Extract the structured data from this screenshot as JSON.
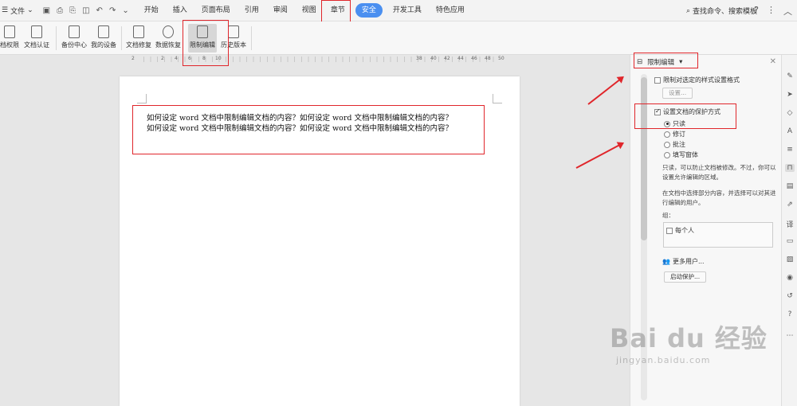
{
  "menubar": {
    "file_label": "文件",
    "tabs": [
      "开始",
      "插入",
      "页面布局",
      "引用",
      "审阅",
      "视图",
      "章节",
      "安全",
      "开发工具",
      "特色应用"
    ],
    "search_label": "查找命令、搜索模板"
  },
  "ribbon": {
    "buttons": [
      "档权限",
      "文档认证",
      "备份中心",
      "我的设备",
      "文档修复",
      "数据恢复",
      "限制编辑",
      "历史版本"
    ]
  },
  "ruler": {
    "ticks": [
      "2",
      "2",
      "4",
      "6",
      "8",
      "10",
      "38",
      "40",
      "42",
      "44",
      "46",
      "48",
      "50"
    ]
  },
  "document": {
    "lines": [
      "如何设定 word 文档中限制编辑文档的内容？如何设定 word 文档中限制编辑文档的内容？",
      "如何设定 word 文档中限制编辑文档的内容？如何设定 word 文档中限制编辑文档的内容？"
    ]
  },
  "panel": {
    "title": "限制编辑",
    "format_restrict_label": "限制对选定的样式设置格式",
    "settings_button": "设置...",
    "protect_label": "设置文档的保护方式",
    "options": [
      "只读",
      "修订",
      "批注",
      "填写窗体"
    ],
    "readonly_desc": "只读，可以防止文档被修改。不过，你可以设置允许编辑的区域。",
    "select_desc": "在文档中选择部分内容，并选择可以对其进行编辑的用户。",
    "group_label": "组：",
    "everyone_label": "每个人",
    "more_users": "更多用户...",
    "start_protect": "启动保护..."
  },
  "watermark": {
    "brand": "Bai du 经验",
    "url": "jingyan.baidu.com"
  }
}
